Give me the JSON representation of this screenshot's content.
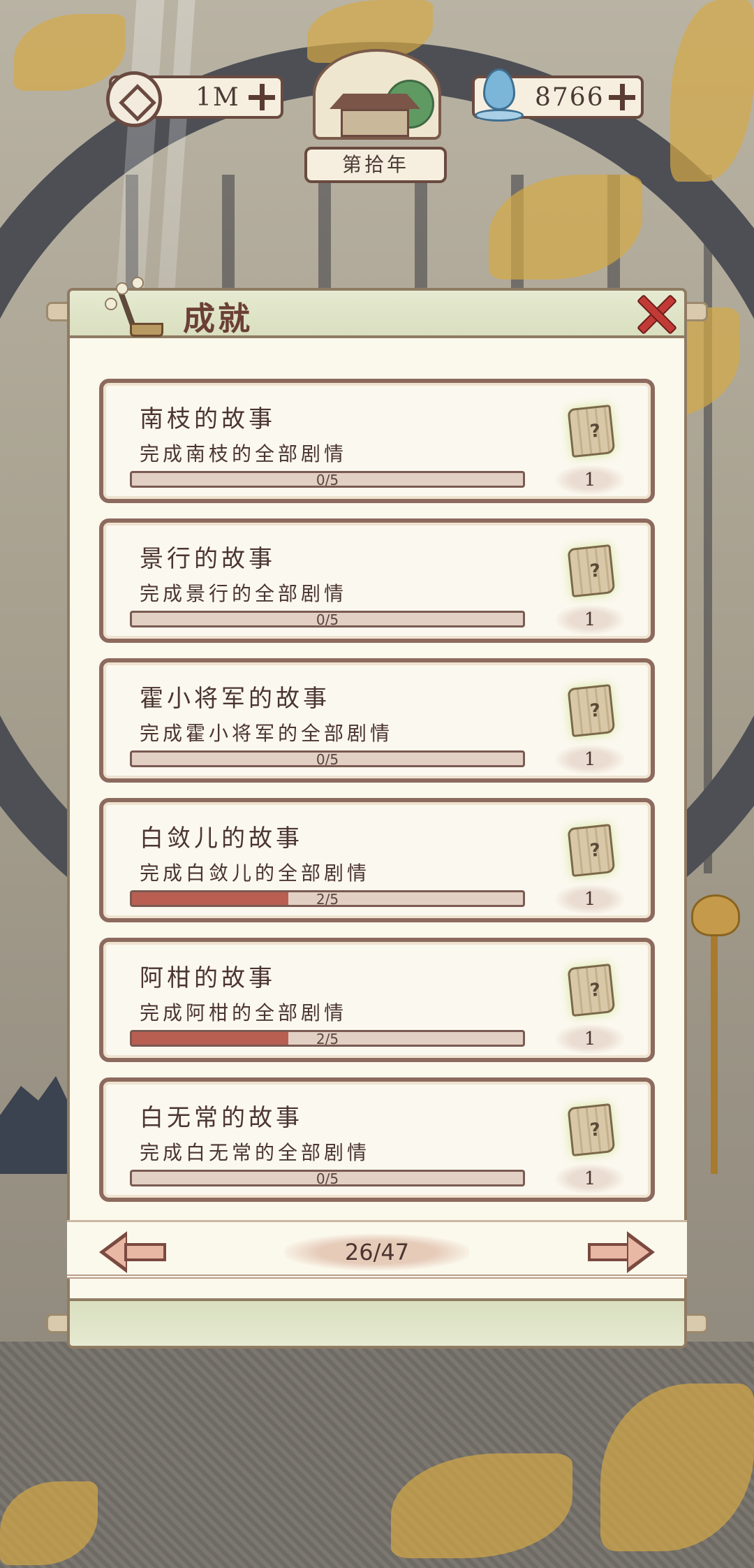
{
  "hud": {
    "coins": "1M",
    "spirit": "8766",
    "year": "第拾年"
  },
  "panel": {
    "title": "成就"
  },
  "achievements": [
    {
      "title": "南枝的故事",
      "description": "完成南枝的全部剧情",
      "progress_text": "0/5",
      "progress": 0.0,
      "reward_count": "1"
    },
    {
      "title": "景行的故事",
      "description": "完成景行的全部剧情",
      "progress_text": "0/5",
      "progress": 0.0,
      "reward_count": "1"
    },
    {
      "title": "霍小将军的故事",
      "description": "完成霍小将军的全部剧情",
      "progress_text": "0/5",
      "progress": 0.0,
      "reward_count": "1"
    },
    {
      "title": "白敛儿的故事",
      "description": "完成白敛儿的全部剧情",
      "progress_text": "2/5",
      "progress": 0.4,
      "reward_count": "1"
    },
    {
      "title": "阿柑的故事",
      "description": "完成阿柑的全部剧情",
      "progress_text": "2/5",
      "progress": 0.4,
      "reward_count": "1"
    },
    {
      "title": "白无常的故事",
      "description": "完成白无常的全部剧情",
      "progress_text": "0/5",
      "progress": 0.0,
      "reward_count": "1"
    }
  ],
  "pagination": {
    "page": "26/47"
  },
  "colors": {
    "progress_fill": "#b95f52",
    "close_red": "#c23a36",
    "card_border": "#8d6a5e"
  },
  "icons": {
    "coin": "coin-icon",
    "spirit": "water-drop-icon",
    "reward": "scroll-icon",
    "close": "close-icon"
  }
}
